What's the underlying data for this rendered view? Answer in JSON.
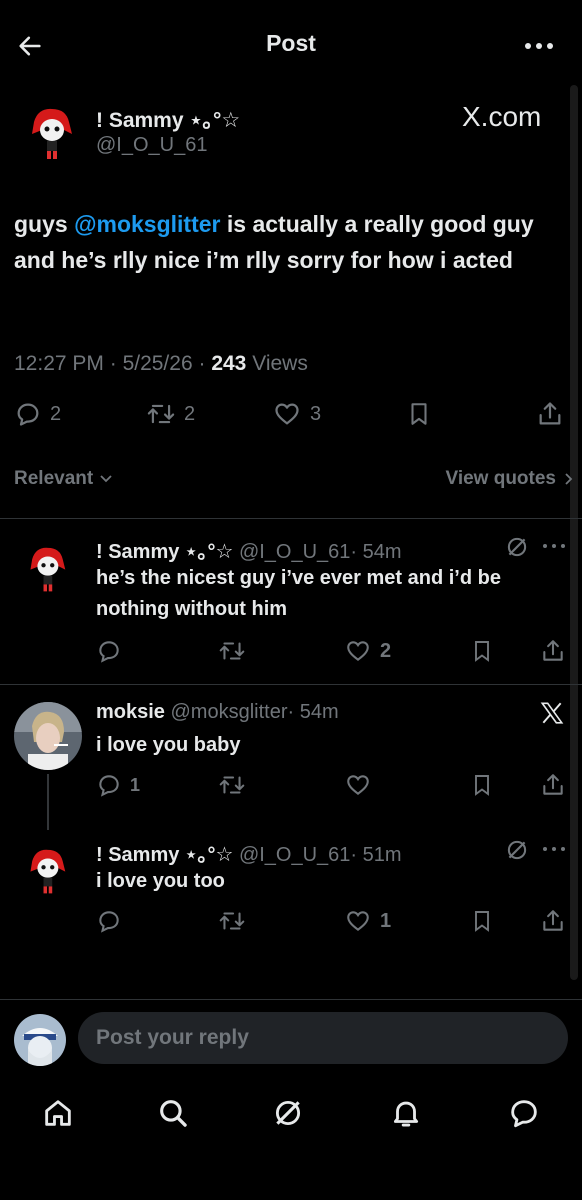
{
  "header": {
    "title": "Post"
  },
  "main_post": {
    "display_name": "! Sammy ⋆｡°☆",
    "handle": "@I_O_U_61",
    "source_badge": "X.com",
    "text_prefix": "guys ",
    "mention": "@moksglitter",
    "text_suffix": " is actually a really good guy and he’s rlly nice i’m rlly sorry for how i acted",
    "time": "12:27 PM",
    "date": "5/25/26",
    "views_count": "243",
    "views_label": "Views",
    "replies": "2",
    "reposts": "2",
    "likes": "3"
  },
  "sort": {
    "label": "Relevant",
    "quotes_label": "View quotes"
  },
  "replies": [
    {
      "display_name": "! Sammy ⋆｡°☆",
      "handle": "@I_O_U_61",
      "time": "· 54m",
      "text": "he’s the nicest guy i’ve ever met and i’d be nothing without him",
      "replies": "",
      "reposts": "",
      "likes": "2"
    },
    {
      "display_name": "moksie",
      "handle": "@moksglitter",
      "time": "· 54m",
      "text": "i love you baby",
      "replies": "1",
      "reposts": "",
      "likes": ""
    },
    {
      "display_name": "! Sammy ⋆｡°☆",
      "handle": "@I_O_U_61",
      "time": "· 51m",
      "text": "i love you too",
      "replies": "",
      "reposts": "",
      "likes": "1"
    }
  ],
  "reply_bar": {
    "placeholder": "Post your reply"
  },
  "colors": {
    "accent": "#1d9bf0",
    "muted": "#71767b",
    "background": "#000000",
    "text": "#e7e9ea"
  },
  "icons": [
    "back-arrow-icon",
    "more-icon",
    "reply-icon",
    "repost-icon",
    "like-icon",
    "bookmark-icon",
    "share-icon",
    "grok-icon",
    "x-logo-icon",
    "home-icon",
    "search-icon",
    "notifications-icon",
    "messages-icon"
  ]
}
